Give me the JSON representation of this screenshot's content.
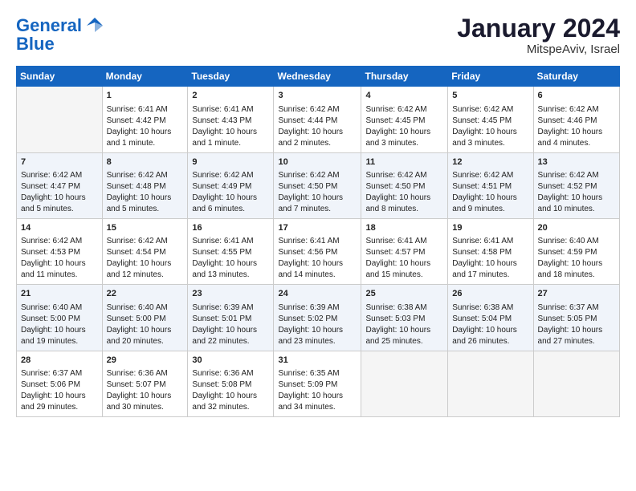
{
  "logo": {
    "line1": "General",
    "line2": "Blue"
  },
  "title": "January 2024",
  "location": "MitspeAviv, Israel",
  "days_header": [
    "Sunday",
    "Monday",
    "Tuesday",
    "Wednesday",
    "Thursday",
    "Friday",
    "Saturday"
  ],
  "weeks": [
    [
      {
        "day": "",
        "sunrise": "",
        "sunset": "",
        "daylight": ""
      },
      {
        "day": "1",
        "sunrise": "Sunrise: 6:41 AM",
        "sunset": "Sunset: 4:42 PM",
        "daylight": "Daylight: 10 hours and 1 minute."
      },
      {
        "day": "2",
        "sunrise": "Sunrise: 6:41 AM",
        "sunset": "Sunset: 4:43 PM",
        "daylight": "Daylight: 10 hours and 1 minute."
      },
      {
        "day": "3",
        "sunrise": "Sunrise: 6:42 AM",
        "sunset": "Sunset: 4:44 PM",
        "daylight": "Daylight: 10 hours and 2 minutes."
      },
      {
        "day": "4",
        "sunrise": "Sunrise: 6:42 AM",
        "sunset": "Sunset: 4:45 PM",
        "daylight": "Daylight: 10 hours and 3 minutes."
      },
      {
        "day": "5",
        "sunrise": "Sunrise: 6:42 AM",
        "sunset": "Sunset: 4:45 PM",
        "daylight": "Daylight: 10 hours and 3 minutes."
      },
      {
        "day": "6",
        "sunrise": "Sunrise: 6:42 AM",
        "sunset": "Sunset: 4:46 PM",
        "daylight": "Daylight: 10 hours and 4 minutes."
      }
    ],
    [
      {
        "day": "7",
        "sunrise": "Sunrise: 6:42 AM",
        "sunset": "Sunset: 4:47 PM",
        "daylight": "Daylight: 10 hours and 5 minutes."
      },
      {
        "day": "8",
        "sunrise": "Sunrise: 6:42 AM",
        "sunset": "Sunset: 4:48 PM",
        "daylight": "Daylight: 10 hours and 5 minutes."
      },
      {
        "day": "9",
        "sunrise": "Sunrise: 6:42 AM",
        "sunset": "Sunset: 4:49 PM",
        "daylight": "Daylight: 10 hours and 6 minutes."
      },
      {
        "day": "10",
        "sunrise": "Sunrise: 6:42 AM",
        "sunset": "Sunset: 4:50 PM",
        "daylight": "Daylight: 10 hours and 7 minutes."
      },
      {
        "day": "11",
        "sunrise": "Sunrise: 6:42 AM",
        "sunset": "Sunset: 4:50 PM",
        "daylight": "Daylight: 10 hours and 8 minutes."
      },
      {
        "day": "12",
        "sunrise": "Sunrise: 6:42 AM",
        "sunset": "Sunset: 4:51 PM",
        "daylight": "Daylight: 10 hours and 9 minutes."
      },
      {
        "day": "13",
        "sunrise": "Sunrise: 6:42 AM",
        "sunset": "Sunset: 4:52 PM",
        "daylight": "Daylight: 10 hours and 10 minutes."
      }
    ],
    [
      {
        "day": "14",
        "sunrise": "Sunrise: 6:42 AM",
        "sunset": "Sunset: 4:53 PM",
        "daylight": "Daylight: 10 hours and 11 minutes."
      },
      {
        "day": "15",
        "sunrise": "Sunrise: 6:42 AM",
        "sunset": "Sunset: 4:54 PM",
        "daylight": "Daylight: 10 hours and 12 minutes."
      },
      {
        "day": "16",
        "sunrise": "Sunrise: 6:41 AM",
        "sunset": "Sunset: 4:55 PM",
        "daylight": "Daylight: 10 hours and 13 minutes."
      },
      {
        "day": "17",
        "sunrise": "Sunrise: 6:41 AM",
        "sunset": "Sunset: 4:56 PM",
        "daylight": "Daylight: 10 hours and 14 minutes."
      },
      {
        "day": "18",
        "sunrise": "Sunrise: 6:41 AM",
        "sunset": "Sunset: 4:57 PM",
        "daylight": "Daylight: 10 hours and 15 minutes."
      },
      {
        "day": "19",
        "sunrise": "Sunrise: 6:41 AM",
        "sunset": "Sunset: 4:58 PM",
        "daylight": "Daylight: 10 hours and 17 minutes."
      },
      {
        "day": "20",
        "sunrise": "Sunrise: 6:40 AM",
        "sunset": "Sunset: 4:59 PM",
        "daylight": "Daylight: 10 hours and 18 minutes."
      }
    ],
    [
      {
        "day": "21",
        "sunrise": "Sunrise: 6:40 AM",
        "sunset": "Sunset: 5:00 PM",
        "daylight": "Daylight: 10 hours and 19 minutes."
      },
      {
        "day": "22",
        "sunrise": "Sunrise: 6:40 AM",
        "sunset": "Sunset: 5:00 PM",
        "daylight": "Daylight: 10 hours and 20 minutes."
      },
      {
        "day": "23",
        "sunrise": "Sunrise: 6:39 AM",
        "sunset": "Sunset: 5:01 PM",
        "daylight": "Daylight: 10 hours and 22 minutes."
      },
      {
        "day": "24",
        "sunrise": "Sunrise: 6:39 AM",
        "sunset": "Sunset: 5:02 PM",
        "daylight": "Daylight: 10 hours and 23 minutes."
      },
      {
        "day": "25",
        "sunrise": "Sunrise: 6:38 AM",
        "sunset": "Sunset: 5:03 PM",
        "daylight": "Daylight: 10 hours and 25 minutes."
      },
      {
        "day": "26",
        "sunrise": "Sunrise: 6:38 AM",
        "sunset": "Sunset: 5:04 PM",
        "daylight": "Daylight: 10 hours and 26 minutes."
      },
      {
        "day": "27",
        "sunrise": "Sunrise: 6:37 AM",
        "sunset": "Sunset: 5:05 PM",
        "daylight": "Daylight: 10 hours and 27 minutes."
      }
    ],
    [
      {
        "day": "28",
        "sunrise": "Sunrise: 6:37 AM",
        "sunset": "Sunset: 5:06 PM",
        "daylight": "Daylight: 10 hours and 29 minutes."
      },
      {
        "day": "29",
        "sunrise": "Sunrise: 6:36 AM",
        "sunset": "Sunset: 5:07 PM",
        "daylight": "Daylight: 10 hours and 30 minutes."
      },
      {
        "day": "30",
        "sunrise": "Sunrise: 6:36 AM",
        "sunset": "Sunset: 5:08 PM",
        "daylight": "Daylight: 10 hours and 32 minutes."
      },
      {
        "day": "31",
        "sunrise": "Sunrise: 6:35 AM",
        "sunset": "Sunset: 5:09 PM",
        "daylight": "Daylight: 10 hours and 34 minutes."
      },
      {
        "day": "",
        "sunrise": "",
        "sunset": "",
        "daylight": ""
      },
      {
        "day": "",
        "sunrise": "",
        "sunset": "",
        "daylight": ""
      },
      {
        "day": "",
        "sunrise": "",
        "sunset": "",
        "daylight": ""
      }
    ]
  ]
}
